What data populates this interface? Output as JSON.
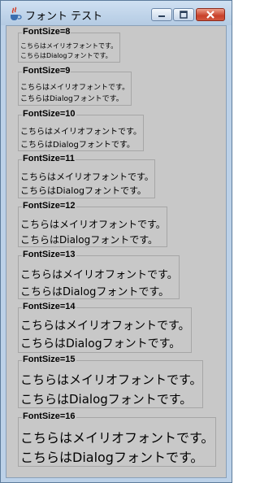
{
  "window": {
    "title": "フォント テスト",
    "controls": {
      "minimize": "minimize-icon",
      "maximize": "maximize-icon",
      "close": "close-icon"
    },
    "app_icon": "java-cup-icon"
  },
  "groups": [
    {
      "label": "FontSize=8",
      "line1": "こちらはメイリオフォントです。",
      "line2": "こちらはDialogフォントです。"
    },
    {
      "label": "FontSize=9",
      "line1": "こちらはメイリオフォントです。",
      "line2": "こちらはDialogフォントです。"
    },
    {
      "label": "FontSize=10",
      "line1": "こちらはメイリオフォントです。",
      "line2": "こちらはDialogフォントです。"
    },
    {
      "label": "FontSize=11",
      "line1": "こちらはメイリオフォントです。",
      "line2": "こちらはDialogフォントです。"
    },
    {
      "label": "FontSize=12",
      "line1": "こちらはメイリオフォントです。",
      "line2": "こちらはDialogフォントです。"
    },
    {
      "label": "FontSize=13",
      "line1": "こちらはメイリオフォントです。",
      "line2": "こちらはDialogフォントです。"
    },
    {
      "label": "FontSize=14",
      "line1": "こちらはメイリオフォントです。",
      "line2": "こちらはDialogフォントです。"
    },
    {
      "label": "FontSize=15",
      "line1": "こちらはメイリオフォントです。",
      "line2": "こちらはDialogフォントです。"
    },
    {
      "label": "FontSize=16",
      "line1": "こちらはメイリオフォントです。",
      "line2": "こちらはDialogフォントです。"
    }
  ]
}
